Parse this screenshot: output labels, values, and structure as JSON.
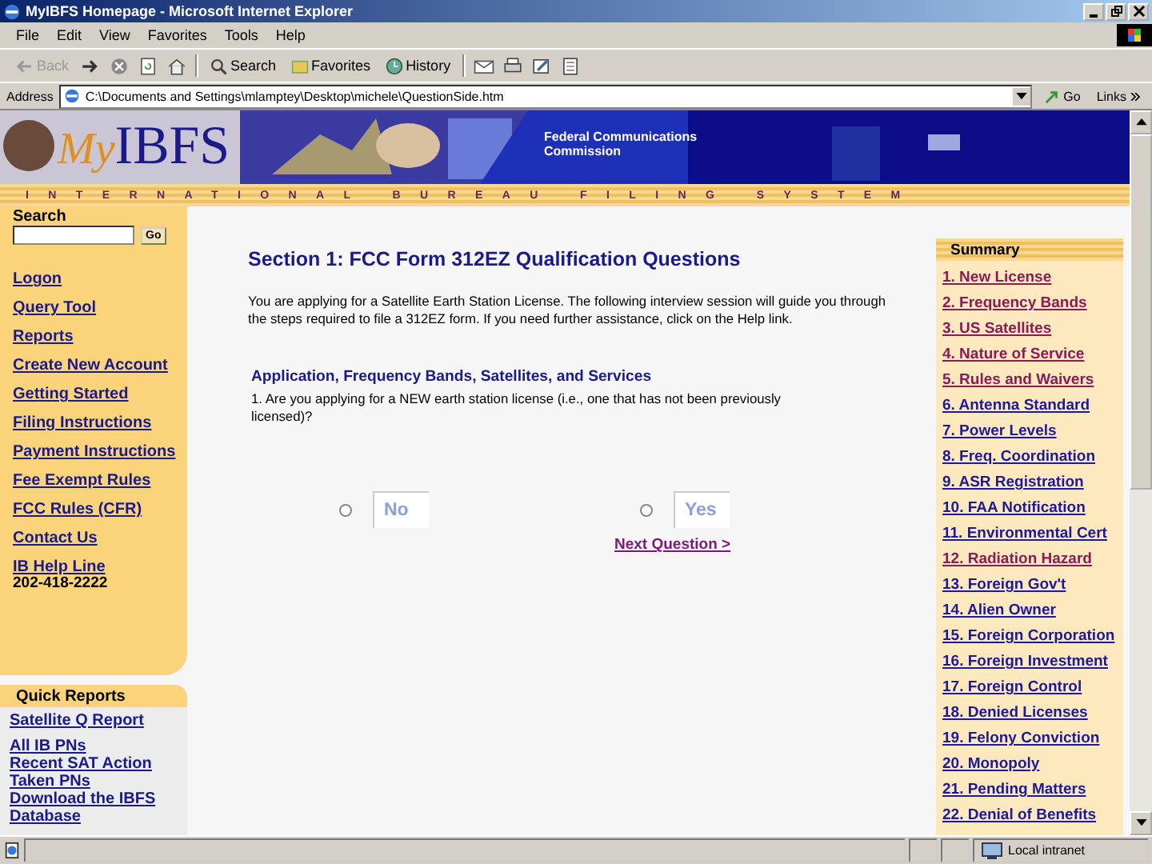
{
  "window": {
    "title": "MyIBFS Homepage - Microsoft Internet Explorer"
  },
  "menu": [
    "File",
    "Edit",
    "View",
    "Favorites",
    "Tools",
    "Help"
  ],
  "toolbar": [
    {
      "label": "Back",
      "disabled": true
    },
    {
      "label": "Search",
      "disabled": false
    },
    {
      "label": "Favorites",
      "disabled": false
    },
    {
      "label": "History",
      "disabled": false
    }
  ],
  "address": {
    "label": "Address",
    "value": "C:\\Documents and Settings\\mlamptey\\Desktop\\michele\\QuestionSide.htm",
    "go": "Go",
    "links": "Links"
  },
  "banner": {
    "logo_prefix": "My",
    "logo": "IBFS",
    "agency": "Federal Communications Commission",
    "tagline": "INTERNATIONAL BUREAU FILING SYSTEM"
  },
  "sidebar": {
    "search_label": "Search",
    "go": "Go",
    "links": [
      "Logon",
      "Query Tool",
      "Reports",
      "Create New Account",
      "Getting Started",
      "Filing Instructions",
      "Payment Instructions",
      "Fee Exempt Rules",
      "FCC Rules (CFR)",
      "Contact Us",
      "IB Help Line"
    ],
    "phone": "202-418-2222",
    "quick_reports_title": "Quick Reports",
    "quick_reports": [
      "Satellite Q Report",
      "All IB PNs",
      "Recent SAT Action",
      "Taken PNs",
      "Download the IBFS",
      "Database"
    ]
  },
  "main": {
    "title": "Section 1: FCC Form 312EZ Qualification Questions",
    "intro": "You are applying for a Satellite Earth Station License. The following interview session will guide you through the steps required to file a 312EZ form. If you need further assistance, click on the Help link.",
    "subtitle": "Application, Frequency Bands, Satellites, and Services",
    "question": "1. Are you applying for a NEW earth station license (i.e., one that has not been previously licensed)?",
    "options": [
      {
        "label": "No",
        "selected": false
      },
      {
        "label": "Yes",
        "selected": false
      }
    ],
    "next": "Next Question >"
  },
  "summary": {
    "title": "Summary",
    "items": [
      {
        "label": "1. New License",
        "visited": true
      },
      {
        "label": "2. Frequency Bands",
        "visited": true
      },
      {
        "label": "3. US Satellites",
        "visited": true
      },
      {
        "label": "4. Nature of Service",
        "visited": true
      },
      {
        "label": "5. Rules and Waivers",
        "visited": true
      },
      {
        "label": "6. Antenna Standard",
        "visited": false
      },
      {
        "label": "7. Power Levels",
        "visited": false
      },
      {
        "label": "8. Freq. Coordination",
        "visited": false
      },
      {
        "label": "9. ASR Registration",
        "visited": false
      },
      {
        "label": "10. FAA Notification",
        "visited": false
      },
      {
        "label": "11. Environmental Cert",
        "visited": false
      },
      {
        "label": "12. Radiation Hazard",
        "visited": true
      },
      {
        "label": "13. Foreign Gov't",
        "visited": false
      },
      {
        "label": "14. Alien Owner",
        "visited": false
      },
      {
        "label": "15. Foreign Corporation",
        "visited": false
      },
      {
        "label": "16. Foreign Investment",
        "visited": false
      },
      {
        "label": "17. Foreign Control",
        "visited": false
      },
      {
        "label": "18. Denied Licenses",
        "visited": false
      },
      {
        "label": "19. Felony Conviction",
        "visited": false
      },
      {
        "label": "20. Monopoly",
        "visited": false
      },
      {
        "label": "21. Pending Matters",
        "visited": false
      },
      {
        "label": "22. Denial of Benefits",
        "visited": false
      }
    ]
  },
  "status_bar": {
    "zone": "Local intranet"
  }
}
